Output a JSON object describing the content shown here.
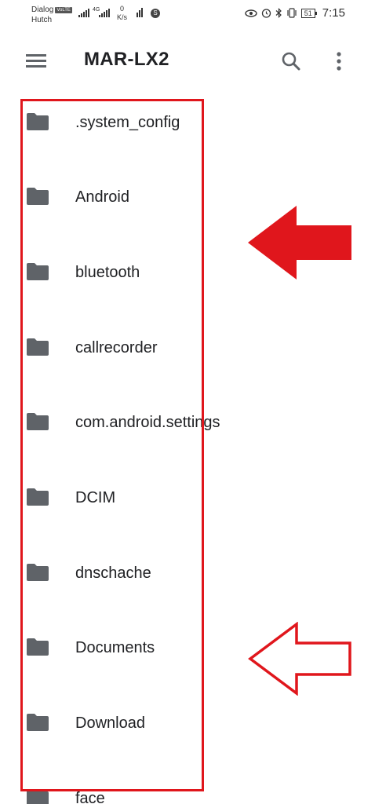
{
  "status_bar": {
    "carrier_1": "Dialog",
    "volte": "VoLTE",
    "carrier_2": "Hutch",
    "network": "4G",
    "speed_value": "0",
    "speed_unit": "K/s",
    "battery": "51",
    "time": "7:15"
  },
  "app_bar": {
    "title": "MAR-LX2",
    "menu_icon": "hamburger-menu-icon",
    "search_icon": "search-icon",
    "more_icon": "more-vert-icon"
  },
  "files": [
    {
      "name": ".system_config",
      "icon": "folder-icon"
    },
    {
      "name": "Android",
      "icon": "folder-icon"
    },
    {
      "name": "bluetooth",
      "icon": "folder-icon"
    },
    {
      "name": "callrecorder",
      "icon": "folder-icon"
    },
    {
      "name": "com.android.settings",
      "icon": "folder-icon"
    },
    {
      "name": "DCIM",
      "icon": "folder-icon"
    },
    {
      "name": "dnschache",
      "icon": "folder-icon"
    },
    {
      "name": "Documents",
      "icon": "folder-icon"
    },
    {
      "name": "Download",
      "icon": "folder-icon"
    },
    {
      "name": "face",
      "icon": "folder-icon"
    }
  ],
  "colors": {
    "annotation": "#e0161c",
    "folder": "#5f6368",
    "text": "#202124"
  }
}
